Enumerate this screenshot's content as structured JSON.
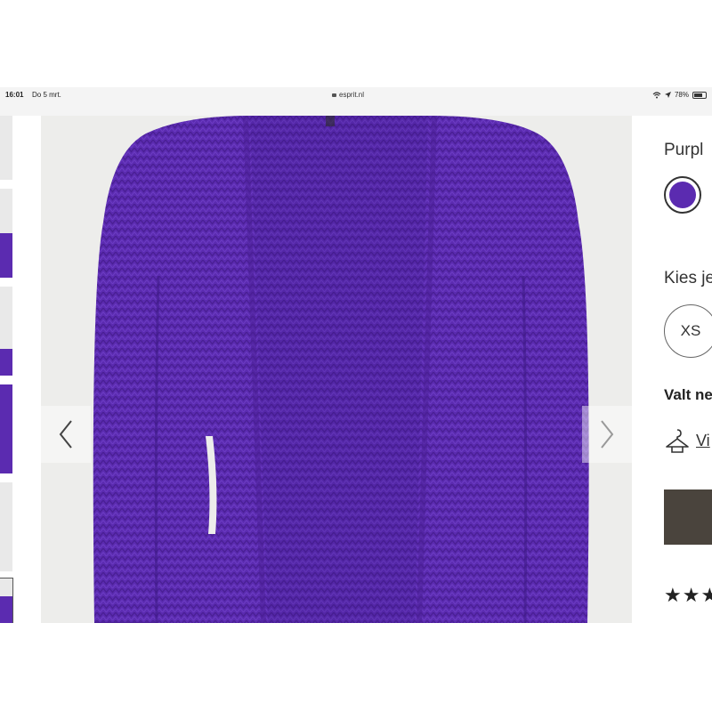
{
  "status_bar": {
    "time": "16:01",
    "date": "Do 5 mrt.",
    "url": "esprit.nl",
    "battery_percent": "78%",
    "battery_level": 0.78,
    "icons": [
      "wifi-icon",
      "location-icon",
      "battery-icon",
      "lock-icon"
    ]
  },
  "gallery": {
    "thumbnail_count": 6,
    "prev_icon": "chevron-left-icon",
    "next_icon": "chevron-right-icon",
    "product_color": "#5b2bb0"
  },
  "product": {
    "color_label": "Purpl",
    "swatch_color": "#5b2bb0",
    "size_prompt": "Kies je",
    "sizes": [
      "XS"
    ],
    "fit_heading": "Valt ne",
    "fit_link": "Vi",
    "fit_icon": "hanger-icon",
    "add_button_color": "#4a443d",
    "rating_stars": "★★★"
  }
}
